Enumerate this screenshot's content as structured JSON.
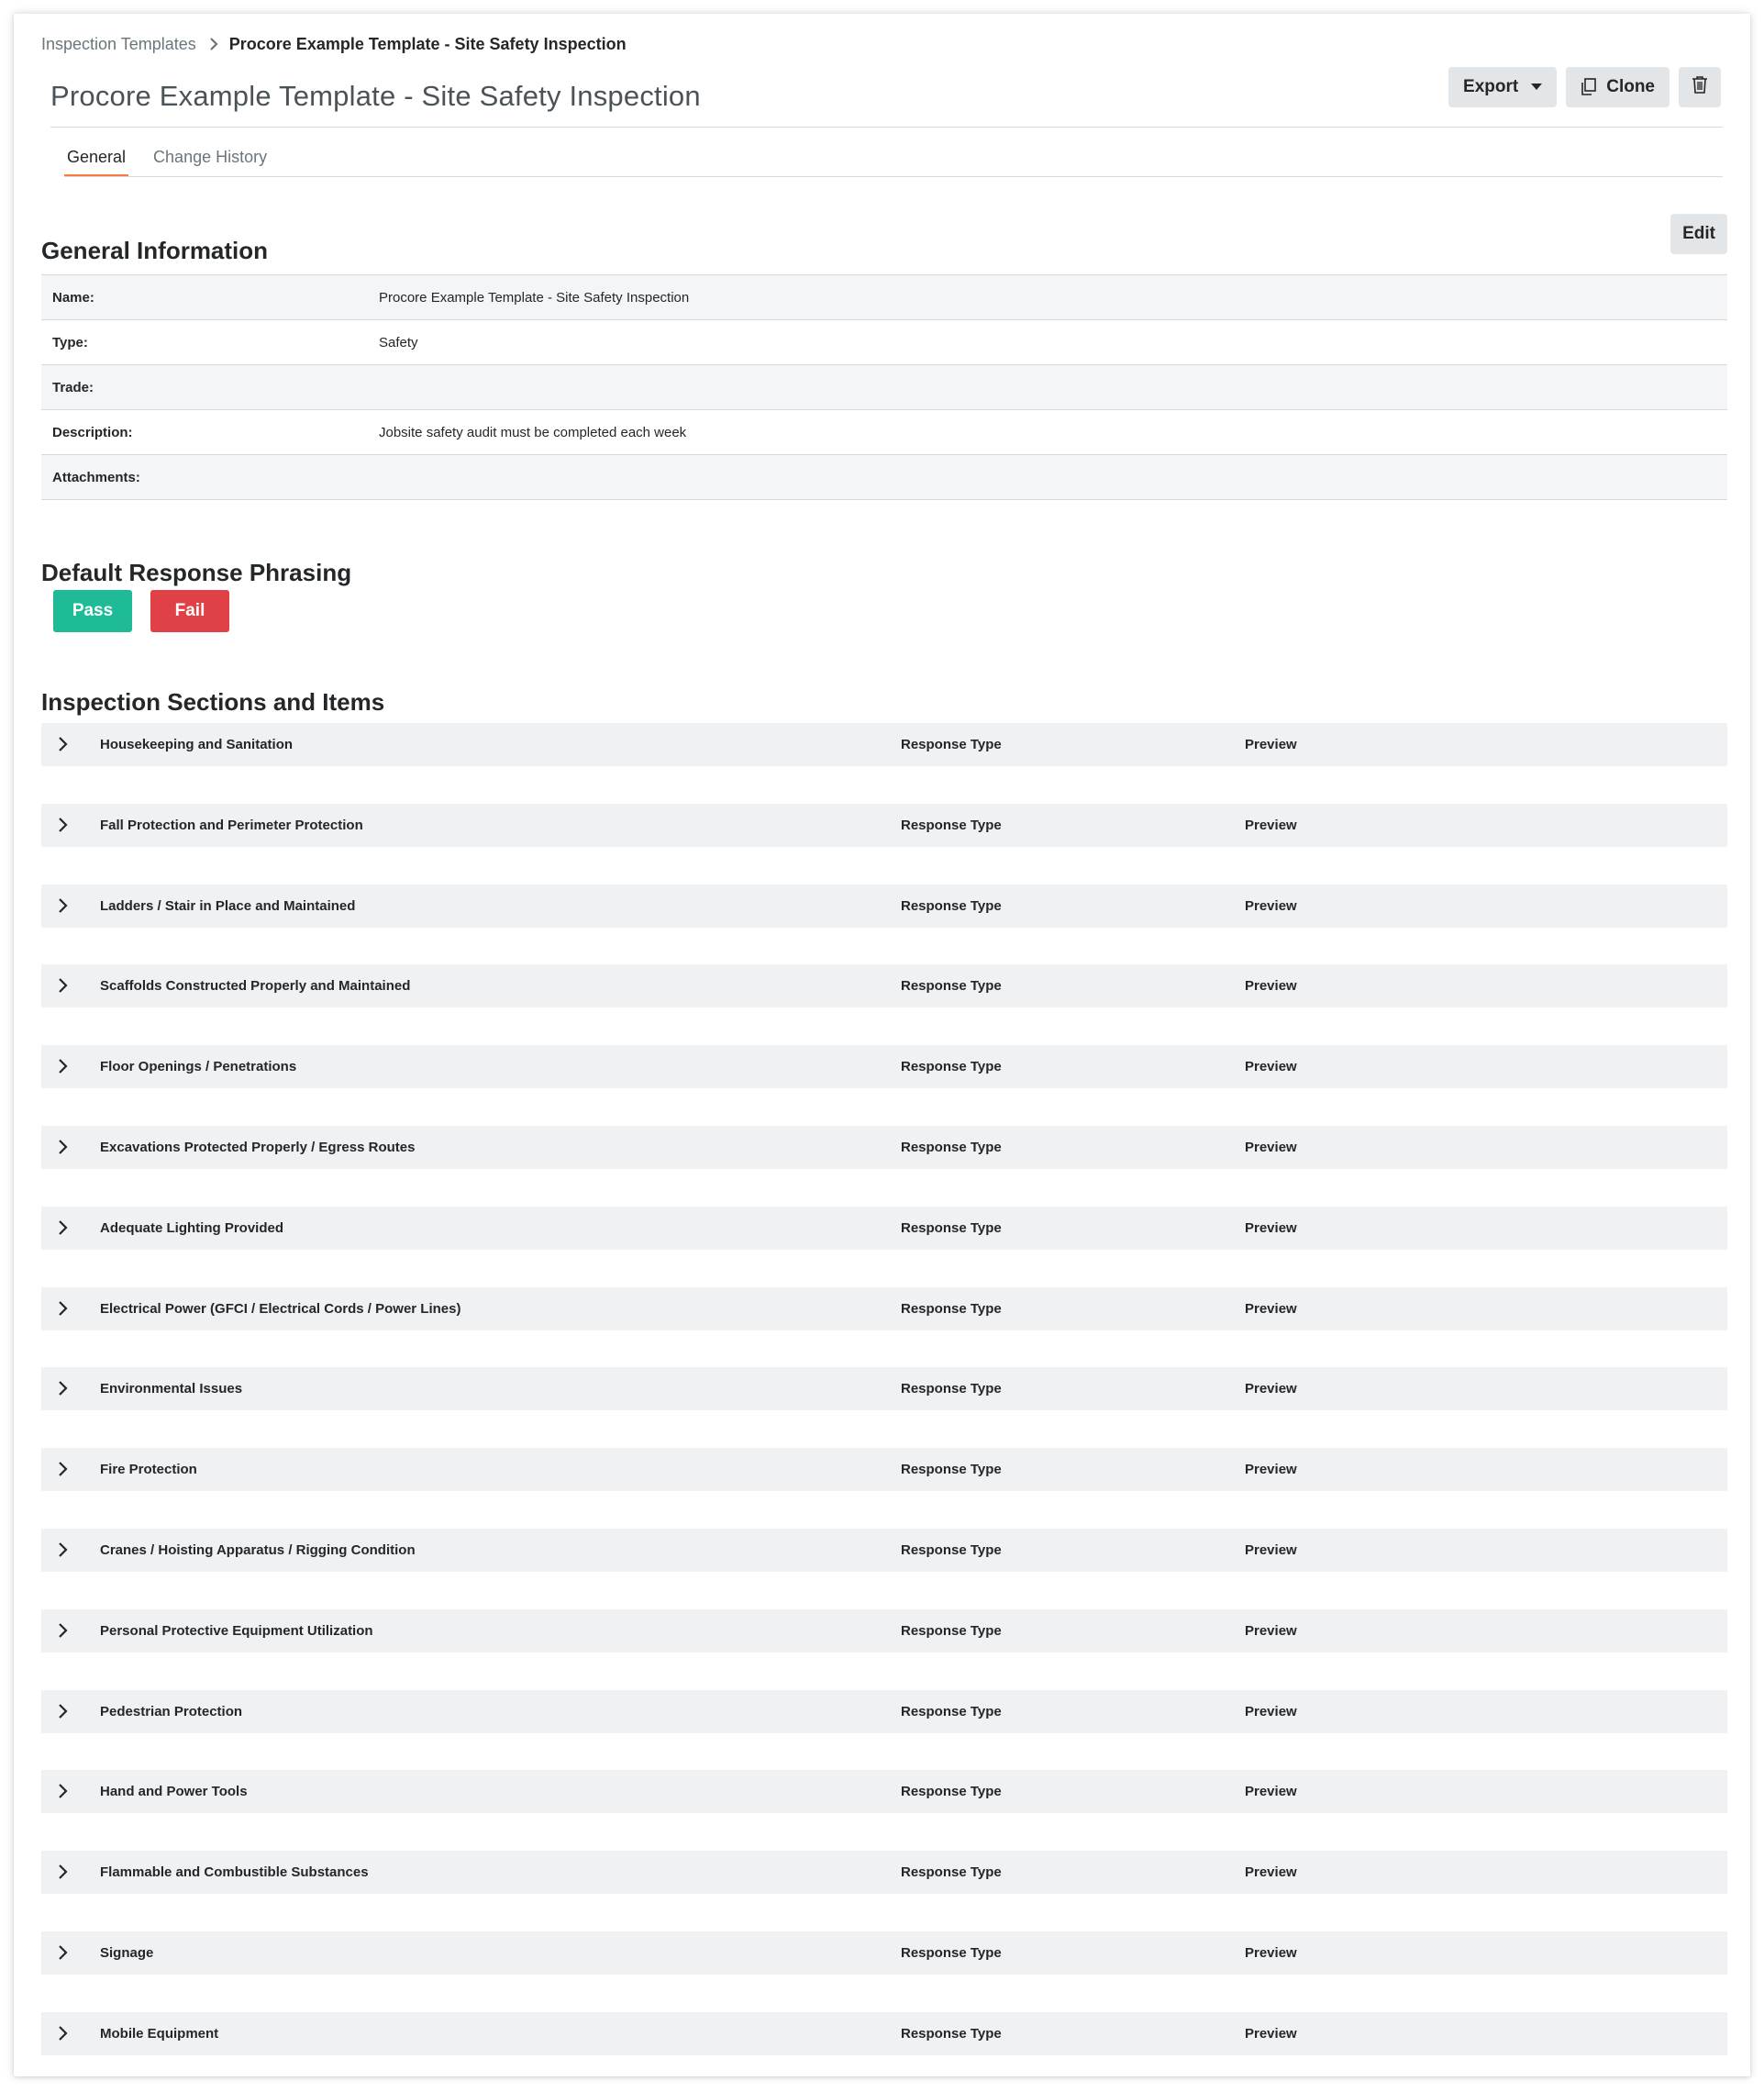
{
  "breadcrumb": {
    "parent": "Inspection Templates",
    "current": "Procore Example Template - Site Safety Inspection"
  },
  "header": {
    "title": "Procore Example Template - Site Safety Inspection",
    "export_label": "Export",
    "clone_label": "Clone"
  },
  "tabs": [
    {
      "label": "General",
      "active": true
    },
    {
      "label": "Change History",
      "active": false
    }
  ],
  "general_info": {
    "heading": "General Information",
    "edit_label": "Edit",
    "rows": [
      {
        "label": "Name:",
        "value": "Procore Example Template - Site Safety Inspection"
      },
      {
        "label": "Type:",
        "value": "Safety"
      },
      {
        "label": "Trade:",
        "value": ""
      },
      {
        "label": "Description:",
        "value": "Jobsite safety audit must be completed each week"
      },
      {
        "label": "Attachments:",
        "value": ""
      }
    ]
  },
  "default_response": {
    "heading": "Default Response Phrasing",
    "pass_label": "Pass",
    "fail_label": "Fail"
  },
  "sections": {
    "heading": "Inspection Sections and Items",
    "response_type_label": "Response Type",
    "preview_label": "Preview",
    "items": [
      "Housekeeping and Sanitation",
      "Fall Protection and Perimeter Protection",
      "Ladders / Stair in Place and Maintained",
      "Scaffolds Constructed Properly and Maintained",
      "Floor Openings / Penetrations",
      "Excavations Protected Properly / Egress Routes",
      "Adequate Lighting Provided",
      "Electrical Power (GFCI / Electrical Cords / Power Lines)",
      "Environmental Issues",
      "Fire Protection",
      "Cranes / Hoisting Apparatus / Rigging Condition",
      "Personal Protective Equipment Utilization",
      "Pedestrian Protection",
      "Hand and Power Tools",
      "Flammable and Combustible Substances",
      "Signage",
      "Mobile Equipment"
    ]
  },
  "colors": {
    "pass": "#1fbb96",
    "fail": "#df4146",
    "tab_accent": "#f47e42"
  },
  "icons": {
    "breadcrumb_separator": "chevron-right-icon",
    "export_caret": "caret-down-icon",
    "clone": "copy-icon",
    "delete": "trash-icon",
    "section_expand": "chevron-right-icon"
  }
}
